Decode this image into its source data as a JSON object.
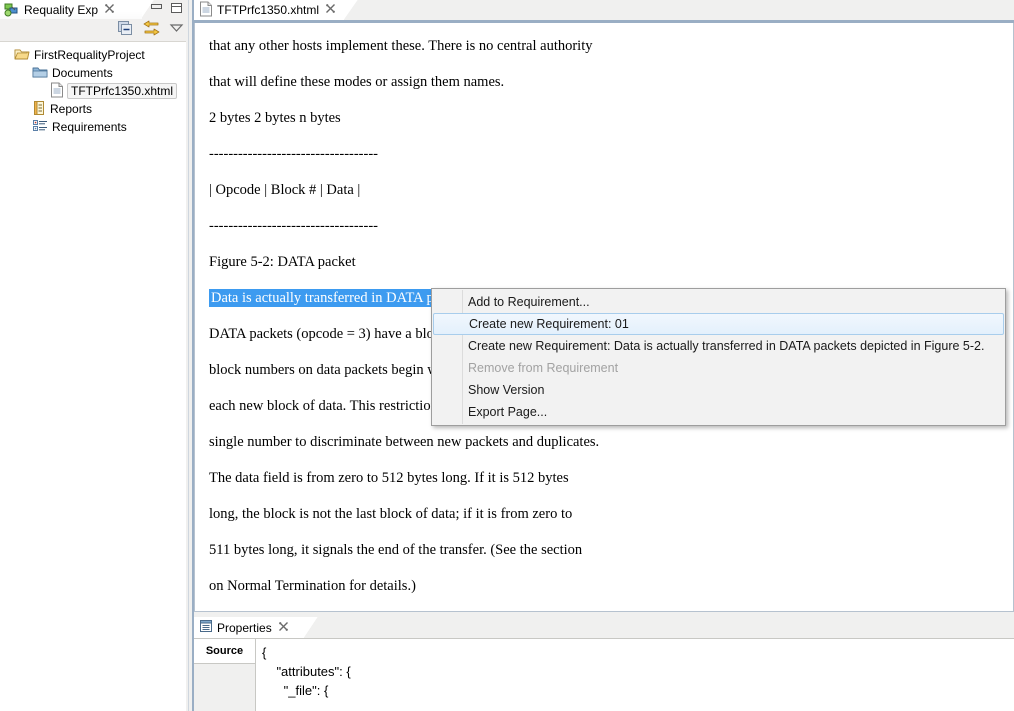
{
  "explorer": {
    "tab_label": "Requality Exp",
    "tab_close": "✕",
    "icon": "requality-explorer-icon",
    "toolbar": {
      "collapse_all": "collapse-all-icon",
      "link_with_editor": "link-with-editor-icon",
      "view_menu": "view-menu-icon"
    },
    "window_controls": {
      "minimize": "minimize-icon",
      "maximize": "maximize-icon"
    },
    "tree": [
      {
        "label": "FirstRequalityProject",
        "icon": "project-folder-icon",
        "indent": 0,
        "selected": false
      },
      {
        "label": "Documents",
        "icon": "folder-icon",
        "indent": 1,
        "selected": false
      },
      {
        "label": "TFTPrfc1350.xhtml",
        "icon": "document-file-icon",
        "indent": 2,
        "selected": true
      },
      {
        "label": "Reports",
        "icon": "reports-icon",
        "indent": 1,
        "selected": false
      },
      {
        "label": "Requirements",
        "icon": "requirements-icon",
        "indent": 1,
        "selected": false
      }
    ]
  },
  "editor": {
    "tab_label": "TFTPrfc1350.xhtml",
    "tab_close": "✕",
    "icon": "xhtml-file-icon",
    "lines": [
      {
        "text": "that any other hosts implement these. There is no central authority",
        "selected": false
      },
      {
        "text": "that will define these modes or assign them names.",
        "selected": false
      },
      {
        "text": "2 bytes 2 bytes n bytes",
        "selected": false
      },
      {
        "text": "-----------------------------------",
        "selected": false
      },
      {
        "text": "| Opcode | Block # | Data |",
        "selected": false
      },
      {
        "text": "-----------------------------------",
        "selected": false
      },
      {
        "text": "Figure 5-2: DATA packet",
        "selected": false
      },
      {
        "text": "Data is actually transferred in DATA packets depicted in Figure 5-2.",
        "selected": true
      },
      {
        "text": "DATA packets (opcode = 3) have a block number and data field. The",
        "selected": false
      },
      {
        "text": "block numbers on data packets begin with one and increase by one for",
        "selected": false
      },
      {
        "text": "each new block of data. This restriction allows the program to use a",
        "selected": false
      },
      {
        "text": "single number to discriminate between new packets and duplicates.",
        "selected": false
      },
      {
        "text": "The data field is from zero to 512 bytes long. If it is 512 bytes",
        "selected": false
      },
      {
        "text": "long, the block is not the last block of data; if it is from zero to",
        "selected": false
      },
      {
        "text": "511 bytes long, it signals the end of the transfer. (See the section",
        "selected": false
      },
      {
        "text": "on Normal Termination for details.)",
        "selected": false
      }
    ]
  },
  "properties": {
    "tab_label": "Properties",
    "tab_close": "✕",
    "icon": "properties-icon",
    "side_tabs": [
      "Source"
    ],
    "source_lines": [
      "{",
      "    \"attributes\": {",
      "      \"_file\": {"
    ]
  },
  "context_menu": {
    "items": [
      {
        "label": "Add to Requirement...",
        "state": "normal"
      },
      {
        "label": "Create new Requirement: 01",
        "state": "highlighted"
      },
      {
        "label": "Create new Requirement: Data is actually transferred in DATA packets depicted in Figure 5-2.",
        "state": "normal"
      },
      {
        "label": "Remove from Requirement",
        "state": "disabled"
      },
      {
        "label": "Show Version",
        "state": "normal"
      },
      {
        "label": "Export Page...",
        "state": "normal"
      }
    ]
  },
  "colors": {
    "selection_blue": "#3d9bf0",
    "tab_underline": "#9aaec4",
    "menu_bg": "#f2f2f2",
    "menu_highlight_border": "#a8cdec",
    "chrome_bg": "#f0f0ef"
  }
}
